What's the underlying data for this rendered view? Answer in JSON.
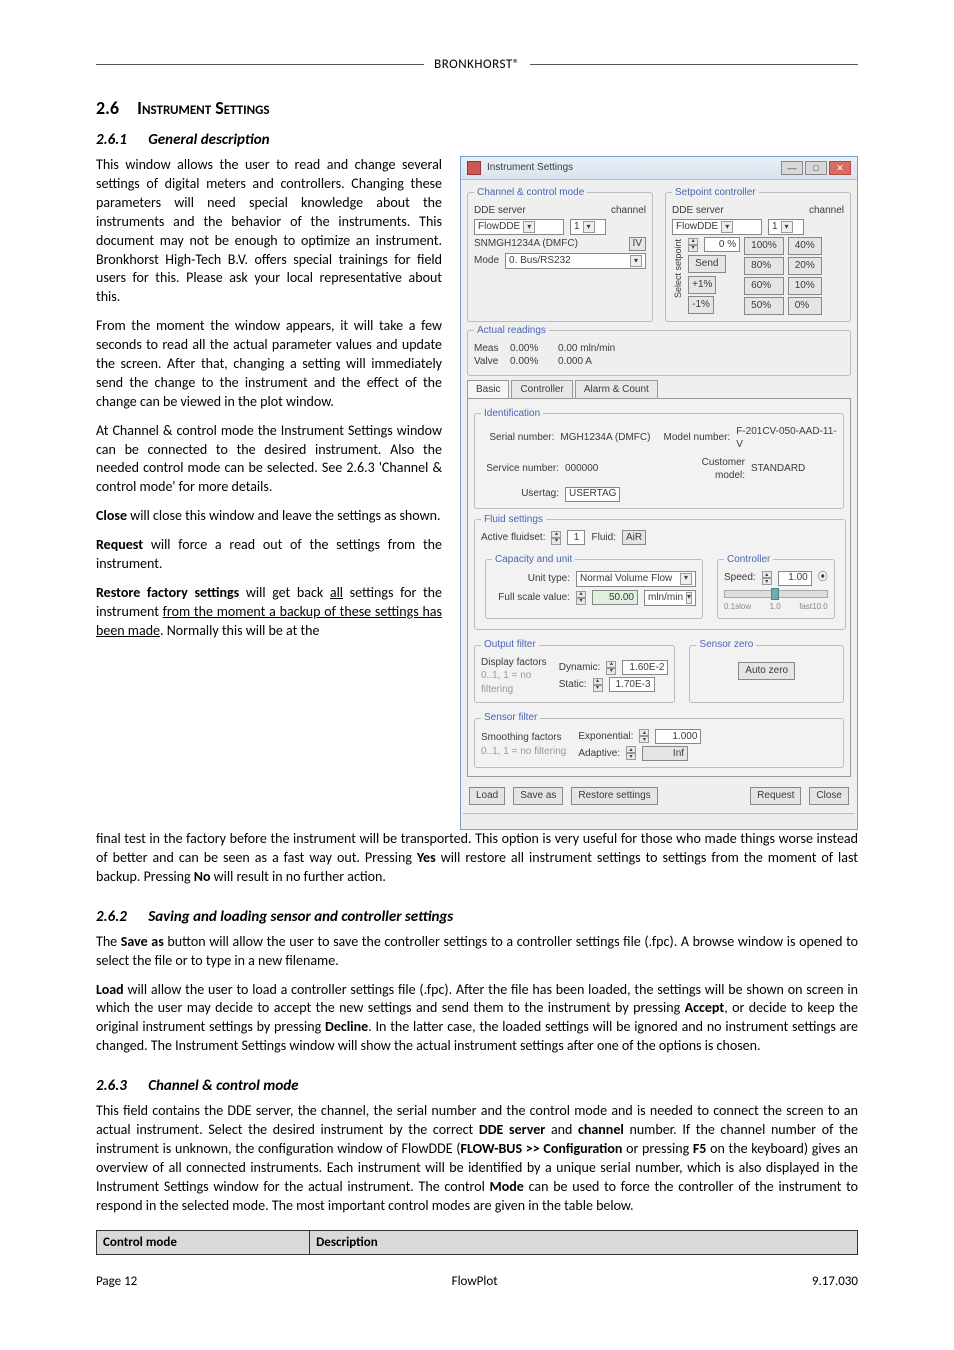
{
  "brand": "BRONKHORST®",
  "sec26": {
    "num": "2.6",
    "title": "Instrument Settings"
  },
  "sec261": {
    "num": "2.6.1",
    "title": "General description"
  },
  "sec262": {
    "num": "2.6.2",
    "title": "Saving and loading sensor and controller settings"
  },
  "sec263": {
    "num": "2.6.3",
    "title": "Channel & control mode"
  },
  "para": {
    "p1": "This window allows the user to read and change several settings of digital meters and controllers. Changing these parameters will need special knowledge about the instruments and the behavior of the instruments. This document may not be enough to optimize an instrument. Bronkhorst High-Tech B.V. offers special trainings for field users for this. Please ask your local representative about this.",
    "p2": "From the moment the window appears, it will take a few seconds to read all the actual parameter values and update the screen. After that, changing a setting will immediately send the change to the instrument and the effect of the change can be viewed in the plot window.",
    "p3": "At Channel & control mode the Instrument Settings window can be connected to the desired instrument. Also the needed control mode can be selected. See 2.6.3 'Channel & control mode' for more details.",
    "p4a": "Close",
    "p4b": " will close this window and leave the settings as shown.",
    "p5a": "Request",
    "p5b": " will force a read out of the settings from the instrument.",
    "p6a": "Restore factory settings",
    "p6b": " will get back ",
    "p6c": "all",
    "p6d": " settings for the instrument ",
    "p6e": "from the moment a backup of these settings has been made",
    "p6f": ". Normally this will be at the",
    "p6g1": "final test in the factory before the instrument will be transported. This option is very useful for those who made things worse instead of better and can be seen as a fast way out. Pressing ",
    "p6g2": " will restore all instrument settings to settings from the moment of last backup. Pressing ",
    "p6g3": " will result in no further action.",
    "yes": "Yes",
    "no": "No",
    "p7a": "The ",
    "p7b": "Save as",
    "p7c": " button will allow the user to save the controller settings to a controller settings file (.fpc). A browse window is opened to select the file or to type in a new filename.",
    "p8a": "Load",
    "p8b": " will allow the user to load a controller settings file (.fpc). After the file has been loaded, the settings will be shown on screen in which the user may decide to accept the new settings and send them to the instrument by pressing ",
    "p8c": "Accept",
    "p8d": ", or decide to keep the original instrument settings by pressing ",
    "p8e": "Decline",
    "p8f": ". In the latter case, the loaded settings will be ignored and no instrument settings are changed. The Instrument Settings window will show the actual instrument settings after one of the options is chosen.",
    "p9a": "This field contains the DDE server, the channel, the serial number and the control mode and is needed to connect the screen to an actual instrument. Select the desired instrument by the correct ",
    "p9b": "DDE server",
    "p9c": " and ",
    "p9d": "channel",
    "p9e": " number. If the channel number of the instrument is unknown, the configuration window of FlowDDE (",
    "p9f": "FLOW-BUS >> Configuration",
    "p9g": " or pressing ",
    "p9h": "F5",
    "p9i": " on the keyboard) gives an overview of all connected instruments. Each instrument will be identified by a unique serial number, which is also displayed in the Instrument Settings window for the actual instrument. The control ",
    "p9j": "Mode",
    "p9k": " can be used to force the controller of the instrument to respond in the selected mode. The most important control modes are given in the table below."
  },
  "table": {
    "h1": "Control mode",
    "h2": "Description"
  },
  "footer": {
    "left": "Page 12",
    "mid": "FlowPlot",
    "right": "9.17.030"
  },
  "win": {
    "title": "Instrument Settings",
    "ch_legend": "Channel & control mode",
    "sp_legend": "Setpoint controller",
    "dde": "DDE server",
    "channel": "channel",
    "flowdde": "FlowDDE",
    "ch1": "1",
    "serial": "SNMGH1234A (DMFC)",
    "iv": "IV",
    "mode": "Mode",
    "mode_val": "0. Bus/RS232",
    "actual_legend": "Actual readings",
    "meas": "Meas",
    "valve": "Valve",
    "v0p": "0.00%",
    "v0mm": "0.00 mln/min",
    "v0a": "0.000 A",
    "setvert": "Select setpoint",
    "pct0": "0 %",
    "send": "Send",
    "b100": "100%",
    "b80": "80%",
    "b60": "60%",
    "b50": "50%",
    "b40": "40%",
    "b20": "20%",
    "b10": "10%",
    "b0": "0%",
    "p1p": "+1%",
    "m1p": "-1%",
    "tab_basic": "Basic",
    "tab_ctrl": "Controller",
    "tab_alarm": "Alarm & Count",
    "ident_legend": "Identification",
    "sn_lbl": "Serial number:",
    "sn_val": "MGH1234A (DMFC)",
    "mn_lbl": "Model number:",
    "mn_val": "F-201CV-050-AAD-11-V",
    "svc_lbl": "Service number:",
    "svc_val": "000000",
    "cust_lbl": "Customer model:",
    "cust_val": "STANDARD",
    "ut_lbl": "Usertag:",
    "ut_val": "USERTAG",
    "fluid_legend": "Fluid settings",
    "af_lbl": "Active fluidset:",
    "af_num": "1",
    "af_fluid_lbl": "Fluid:",
    "af_fluid": "AiR",
    "cap_legend": "Capacity and unit",
    "unit_type_lbl": "Unit type:",
    "unit_type": "Normal Volume Flow",
    "fsv_lbl": "Full scale value:",
    "fsv_val": "50.00",
    "fsv_unit": "mln/min",
    "ctrl_legend": "Controller",
    "speed_lbl": "Speed:",
    "speed_val": "1.00",
    "slow": "0.1slow",
    "mid": "1.0",
    "fast": "fast10.0",
    "of_legend": "Output filter",
    "df_lbl": "Display factors",
    "df_hint": "0..1, 1 = no filtering",
    "dyn_lbl": "Dynamic:",
    "dyn_val": "1.60E-2",
    "stat_lbl": "Static:",
    "stat_val": "1.70E-3",
    "sz_legend": "Sensor zero",
    "az_btn": "Auto zero",
    "sf_legend": "Sensor filter",
    "smf_lbl": "Smoothing factors",
    "exp_lbl": "Exponential:",
    "exp_val": "1.000",
    "adp_lbl": "Adaptive:",
    "adp_val": "Inf",
    "btn_load": "Load",
    "btn_save": "Save as",
    "btn_restore": "Restore settings",
    "btn_req": "Request",
    "btn_close": "Close"
  }
}
